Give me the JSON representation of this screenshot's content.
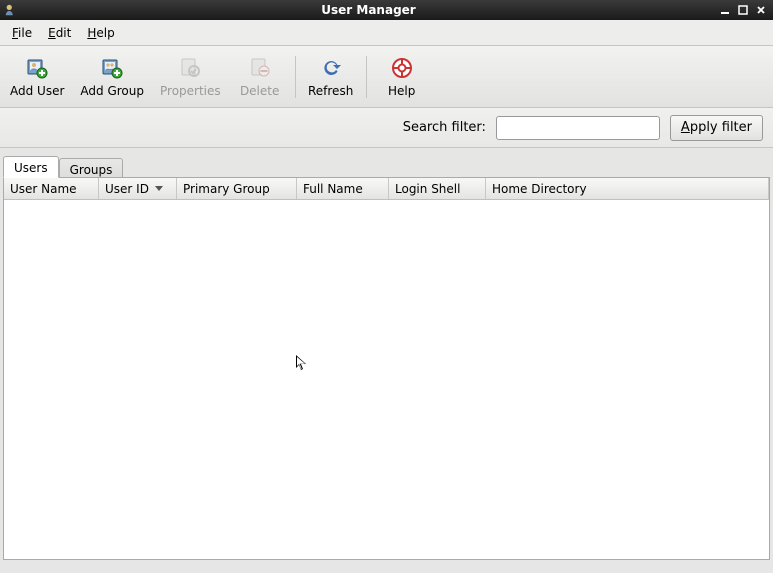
{
  "window": {
    "title": "User Manager"
  },
  "menubar": [
    {
      "label": "File",
      "mnemonic": "F"
    },
    {
      "label": "Edit",
      "mnemonic": "E"
    },
    {
      "label": "Help",
      "mnemonic": "H"
    }
  ],
  "toolbar": {
    "add_user": "Add User",
    "add_group": "Add Group",
    "properties": "Properties",
    "delete": "Delete",
    "refresh": "Refresh",
    "help": "Help"
  },
  "filter": {
    "label": "Search filter:",
    "value": "",
    "apply_label": "Apply filter",
    "apply_mnemonic": "A"
  },
  "tabs": {
    "users": "Users",
    "groups": "Groups",
    "active": "users"
  },
  "columns": {
    "user_name": "User Name",
    "user_id": "User ID",
    "primary_group": "Primary Group",
    "full_name": "Full Name",
    "login_shell": "Login Shell",
    "home_directory": "Home Directory"
  },
  "rows": []
}
